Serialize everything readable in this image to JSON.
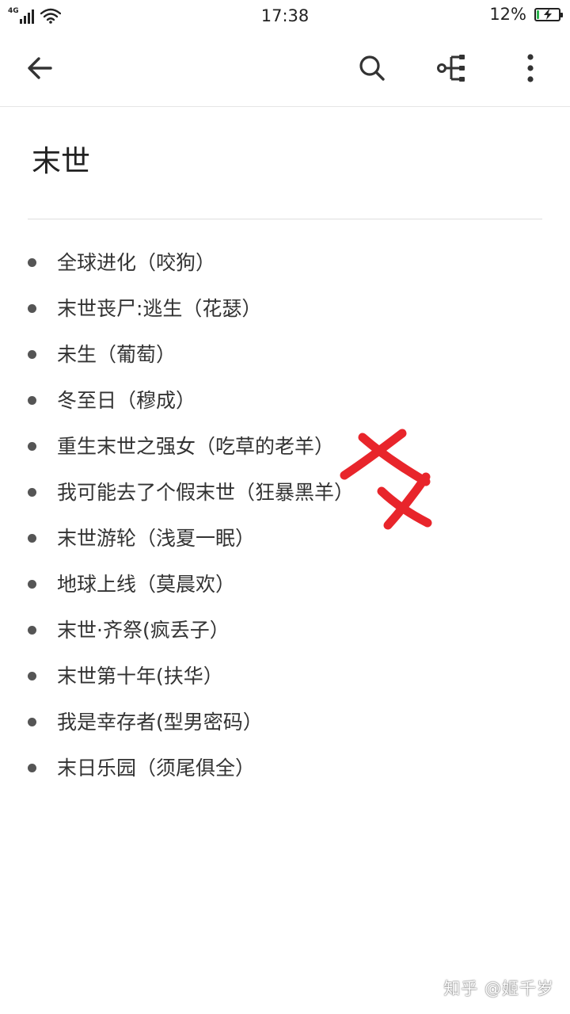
{
  "status_bar": {
    "network": "4G",
    "time": "17:38",
    "battery_percent": "12%",
    "battery_level": 0.12,
    "battery_charging": true,
    "icons": [
      "signal-icon",
      "wifi-icon",
      "battery-icon"
    ]
  },
  "toolbar": {
    "back_icon": "arrow-left-icon",
    "search_icon": "search-icon",
    "share_icon": "share-tree-icon",
    "more_icon": "more-vertical-icon"
  },
  "note": {
    "title": "末世",
    "items": [
      "全球进化（咬狗）",
      "末世丧尸:逃生（花瑟）",
      "未生（葡萄）",
      "冬至日（穆成）",
      "重生末世之强女（吃草的老羊）",
      "我可能去了个假末世（狂暴黑羊）",
      "末世游轮（浅夏一眠）",
      "地球上线（莫晨欢）",
      "末世·齐祭(疯丢子）",
      "末世第十年(扶华）",
      "我是幸存者(型男密码）",
      "末日乐园（须尾俱全）"
    ]
  },
  "annotation": {
    "mark_color": "#e8252b",
    "mark_icon": "red-cross-scribble"
  },
  "watermark": "知乎 @姬千岁"
}
